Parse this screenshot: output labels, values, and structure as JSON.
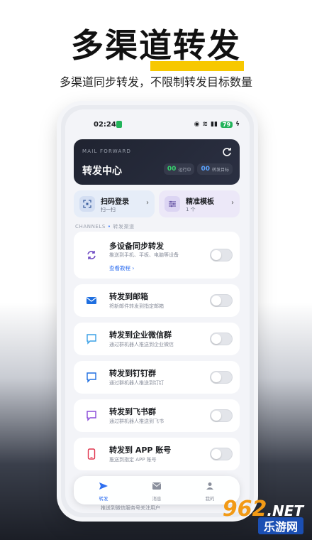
{
  "promo": {
    "title": "多渠道转发",
    "subtitle": "多渠道同步转发，不限制转发目标数量"
  },
  "status_bar": {
    "time": "02:24",
    "battery": "79"
  },
  "hero": {
    "eyebrow": "MAIL FORWARD",
    "title": "转发中心",
    "running_count": "00",
    "running_label": "运行中",
    "targets_count": "00",
    "targets_label": "转发目标"
  },
  "quick_actions": [
    {
      "label": "扫码登录",
      "sub": "扫一扫",
      "icon": "scan-icon"
    },
    {
      "label": "精准模板",
      "sub": "1 个",
      "icon": "sliders-icon"
    }
  ],
  "section": {
    "label_en": "CHANNELS",
    "label_cn": "转发渠道"
  },
  "channels": [
    {
      "title": "多设备同步转发",
      "desc": "推送到手机、平板、电脑等设备",
      "link": "查看教程 ›",
      "icon": "sync-icon",
      "color": "#6b46c1",
      "enabled": false
    },
    {
      "title": "转发到邮箱",
      "desc": "将新邮件转发到指定邮箱",
      "icon": "mail-icon",
      "color": "#1f6fe0",
      "enabled": false
    },
    {
      "title": "转发到企业微信群",
      "desc": "通过群机器人推送到企业微信",
      "icon": "chat-icon",
      "color": "#3aa0e6",
      "enabled": false
    },
    {
      "title": "转发到钉钉群",
      "desc": "通过群机器人推送到钉钉",
      "icon": "chat-icon",
      "color": "#1f6fe0",
      "enabled": false
    },
    {
      "title": "转发到飞书群",
      "desc": "通过群机器人推送到飞书",
      "icon": "chat-icon",
      "color": "#8a4ad8",
      "enabled": false
    },
    {
      "title": "转发到 APP 账号",
      "desc": "推送到指定 APP 账号",
      "icon": "phone-icon",
      "color": "#e0344d",
      "enabled": false
    }
  ],
  "peek_text": "推送到微信服务号关注用户",
  "tabs": [
    {
      "label": "转发",
      "icon": "send-icon",
      "active": true
    },
    {
      "label": "消息",
      "icon": "mail-icon",
      "active": false
    },
    {
      "label": "我的",
      "icon": "user-icon",
      "active": false
    }
  ],
  "watermark": {
    "main": "962",
    "net": ".NET",
    "sub": "乐游网"
  },
  "colors": {
    "accent": "#2f6ff0",
    "highlight": "#f7c800",
    "hero_bg": "#1f2330",
    "green": "#36d06d"
  }
}
